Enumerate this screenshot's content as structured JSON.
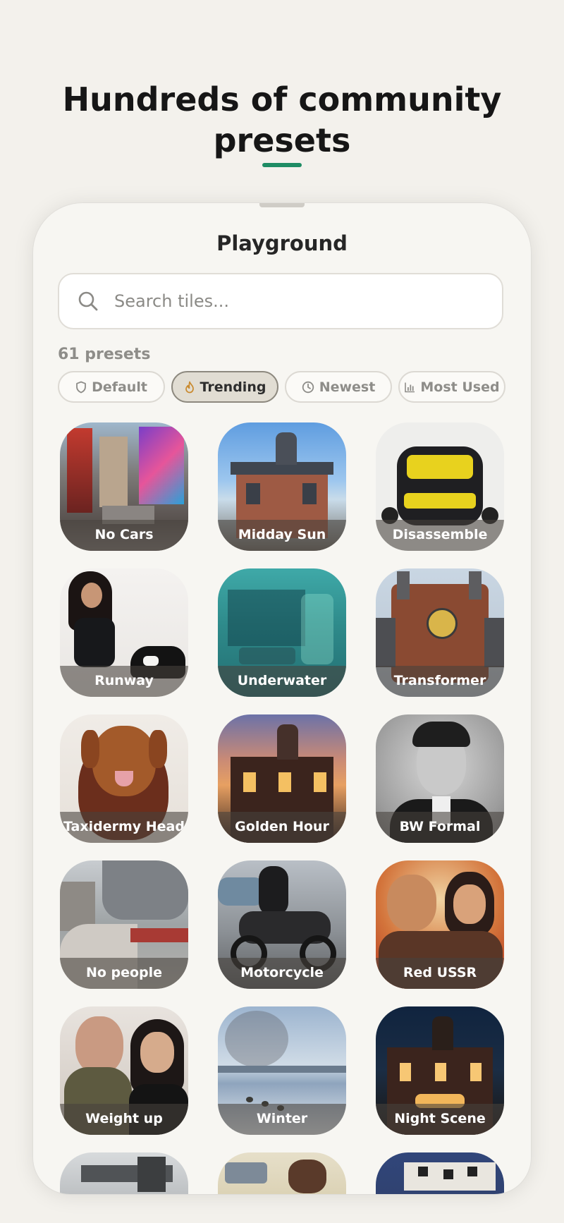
{
  "hero": {
    "title_line1": "Hundreds of community",
    "title_line2": "presets"
  },
  "sheet": {
    "title": "Playground",
    "search": {
      "placeholder": "Search tiles...",
      "value": ""
    },
    "preset_count": "61 presets",
    "filters": [
      {
        "label": "Default",
        "icon": "shield-icon",
        "active": false
      },
      {
        "label": "Trending",
        "icon": "flame-icon",
        "active": true
      },
      {
        "label": "Newest",
        "icon": "clock-icon",
        "active": false
      },
      {
        "label": "Most Used",
        "icon": "bar-chart-icon",
        "active": false
      }
    ],
    "tiles": [
      {
        "label": "No Cars"
      },
      {
        "label": "Midday Sun"
      },
      {
        "label": "Disassemble"
      },
      {
        "label": "Runway"
      },
      {
        "label": "Underwater"
      },
      {
        "label": "Transformer"
      },
      {
        "label": "Taxidermy Head"
      },
      {
        "label": "Golden Hour"
      },
      {
        "label": "BW Formal"
      },
      {
        "label": "No people"
      },
      {
        "label": "Motorcycle"
      },
      {
        "label": "Red USSR"
      },
      {
        "label": "Weight up"
      },
      {
        "label": "Winter"
      },
      {
        "label": "Night Scene"
      },
      {
        "label": ""
      },
      {
        "label": ""
      },
      {
        "label": ""
      }
    ]
  },
  "colors": {
    "accent": "#1e8c64",
    "background": "#f3f1ec"
  }
}
